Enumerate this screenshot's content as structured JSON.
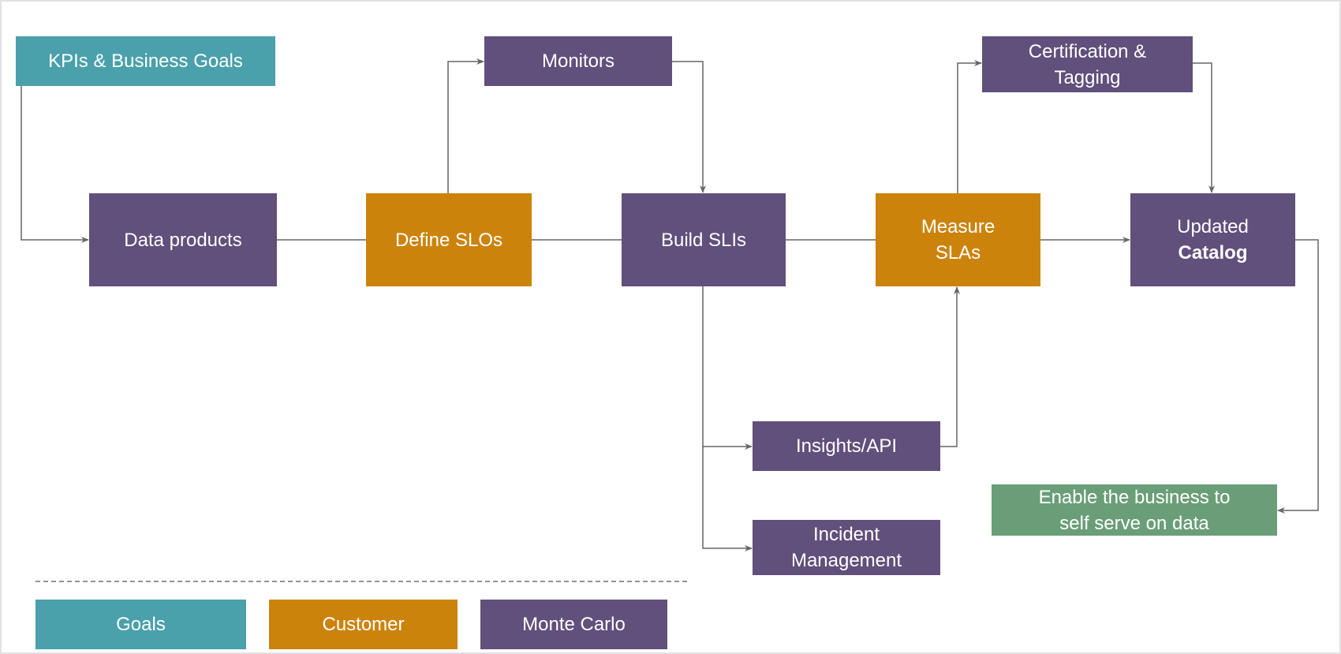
{
  "colors": {
    "goals": "#4aa0ab",
    "customer": "#cc830c",
    "monte_carlo": "#614f7c",
    "outcome": "#6a9e78",
    "connector": "#666666"
  },
  "nodes": {
    "kpis": "KPIs & Business Goals",
    "data_products": "Data products",
    "define_slos": "Define SLOs",
    "build_slis": "Build SLIs",
    "measure_slas": "Measure SLAs",
    "updated_catalog_line1": "Updated",
    "updated_catalog_line2": "Catalog",
    "monitors": "Monitors",
    "certification_line1": "Certification &",
    "certification_line2": "Tagging",
    "insights_api": "Insights/API",
    "incident_line1": "Incident",
    "incident_line2": "Management",
    "enable_line1": "Enable the business to",
    "enable_line2": "self serve on data"
  },
  "legend": {
    "goals": "Goals",
    "customer": "Customer",
    "monte_carlo": "Monte Carlo"
  }
}
